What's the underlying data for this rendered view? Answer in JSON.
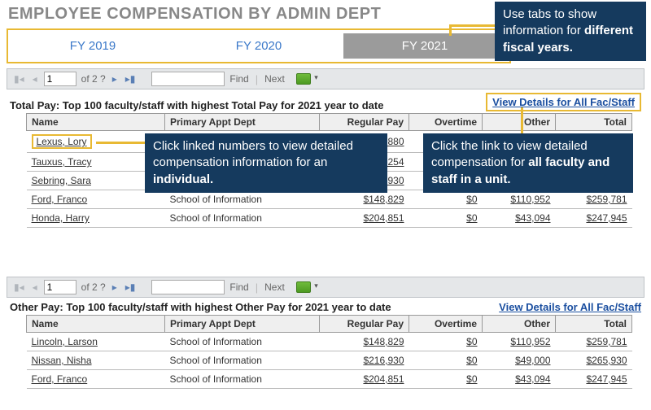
{
  "page_title": "EMPLOYEE COMPENSATION BY ADMIN DEPT",
  "tabs": {
    "fy2019": "FY 2019",
    "fy2020": "FY 2020",
    "fy2021": "FY 2021"
  },
  "toolbar": {
    "page_value": "1",
    "of_text": "of 2 ?",
    "find_label": "Find",
    "next_label": "Next"
  },
  "sections": {
    "total": {
      "heading": "Total Pay: Top 100 faculty/staff with highest Total Pay for 2021 year to date",
      "details_link": "View Details for All Fac/Staff"
    },
    "other": {
      "heading": "Other Pay: Top 100 faculty/staff with highest Other Pay for 2021 year to date",
      "details_link": "View Details for All Fac/Staff"
    }
  },
  "columns": {
    "name": "Name",
    "dept": "Primary Appt Dept",
    "regular": "Regular Pay",
    "overtime": "Overtime",
    "other": "Other",
    "total": "Total"
  },
  "total_rows": [
    {
      "name": "Lexus, Lory",
      "dept": "",
      "regular": "$345,880",
      "overtime": "",
      "other": "",
      "total": ""
    },
    {
      "name": "Tauxus, Tracy",
      "dept": "",
      "regular": "$326,254",
      "overtime": "",
      "other": "",
      "total": ""
    },
    {
      "name": "Sebring, Sara",
      "dept": "",
      "regular": "$216,930",
      "overtime": "",
      "other": "",
      "total": ""
    },
    {
      "name": "Ford, Franco",
      "dept": "School of Information",
      "regular": "$148,829",
      "overtime": "$0",
      "other": "$110,952",
      "total": "$259,781"
    },
    {
      "name": "Honda, Harry",
      "dept": "School of Information",
      "regular": "$204,851",
      "overtime": "$0",
      "other": "$43,094",
      "total": "$247,945"
    }
  ],
  "other_rows": [
    {
      "name": "Lincoln, Larson",
      "dept": "School of Information",
      "regular": "$148,829",
      "overtime": "$0",
      "other": "$110,952",
      "total": "$259,781"
    },
    {
      "name": "Nissan, Nisha",
      "dept": "School of Information",
      "regular": "$216,930",
      "overtime": "$0",
      "other": "$49,000",
      "total": "$265,930"
    },
    {
      "name": "Ford, Franco",
      "dept": "School of Information",
      "regular": "$204,851",
      "overtime": "$0",
      "other": "$43,094",
      "total": "$247,945"
    }
  ],
  "callouts": {
    "tabs": "Use tabs to show information for <b>different fiscal years.</b>",
    "individual": "Click linked numbers to view detailed compensation information for an <b>individual.</b>",
    "unit": "Click the link to view detailed compensation for <b>all faculty and staff in a unit.</b>"
  }
}
